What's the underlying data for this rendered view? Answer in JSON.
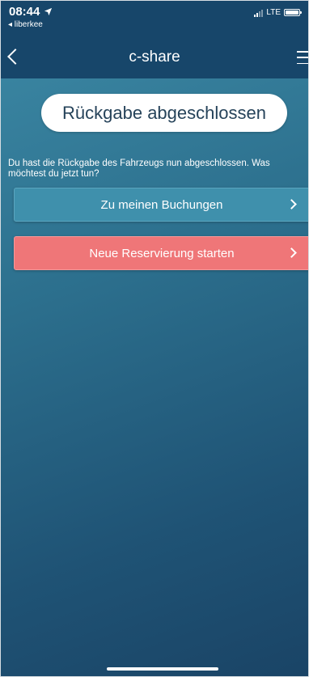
{
  "status_bar": {
    "time": "08:44",
    "location_arrow_icon": "location-arrow-icon",
    "back_app": "◂ liberkee",
    "network": "LTE",
    "battery_icon": "battery-icon",
    "signal_icon": "signal-icon"
  },
  "nav": {
    "title": "c-share",
    "back_icon": "chevron-left-icon",
    "menu_icon": "hamburger-menu-icon"
  },
  "confirmation": {
    "title": "Rückgabe abgeschlossen",
    "message": "Du hast die Rückgabe des Fahrzeugs nun abgeschlossen. Was möchtest du jetzt tun?"
  },
  "actions": {
    "bookings_label": "Zu meinen Buchungen",
    "new_reservation_label": "Neue Reservierung starten",
    "chevron_icon": "chevron-right-icon"
  },
  "colors": {
    "nav_background": "#17466a",
    "bookings_button": "#3f90ac",
    "new_reservation_button": "#ef7678",
    "pill_text": "#26435a"
  }
}
